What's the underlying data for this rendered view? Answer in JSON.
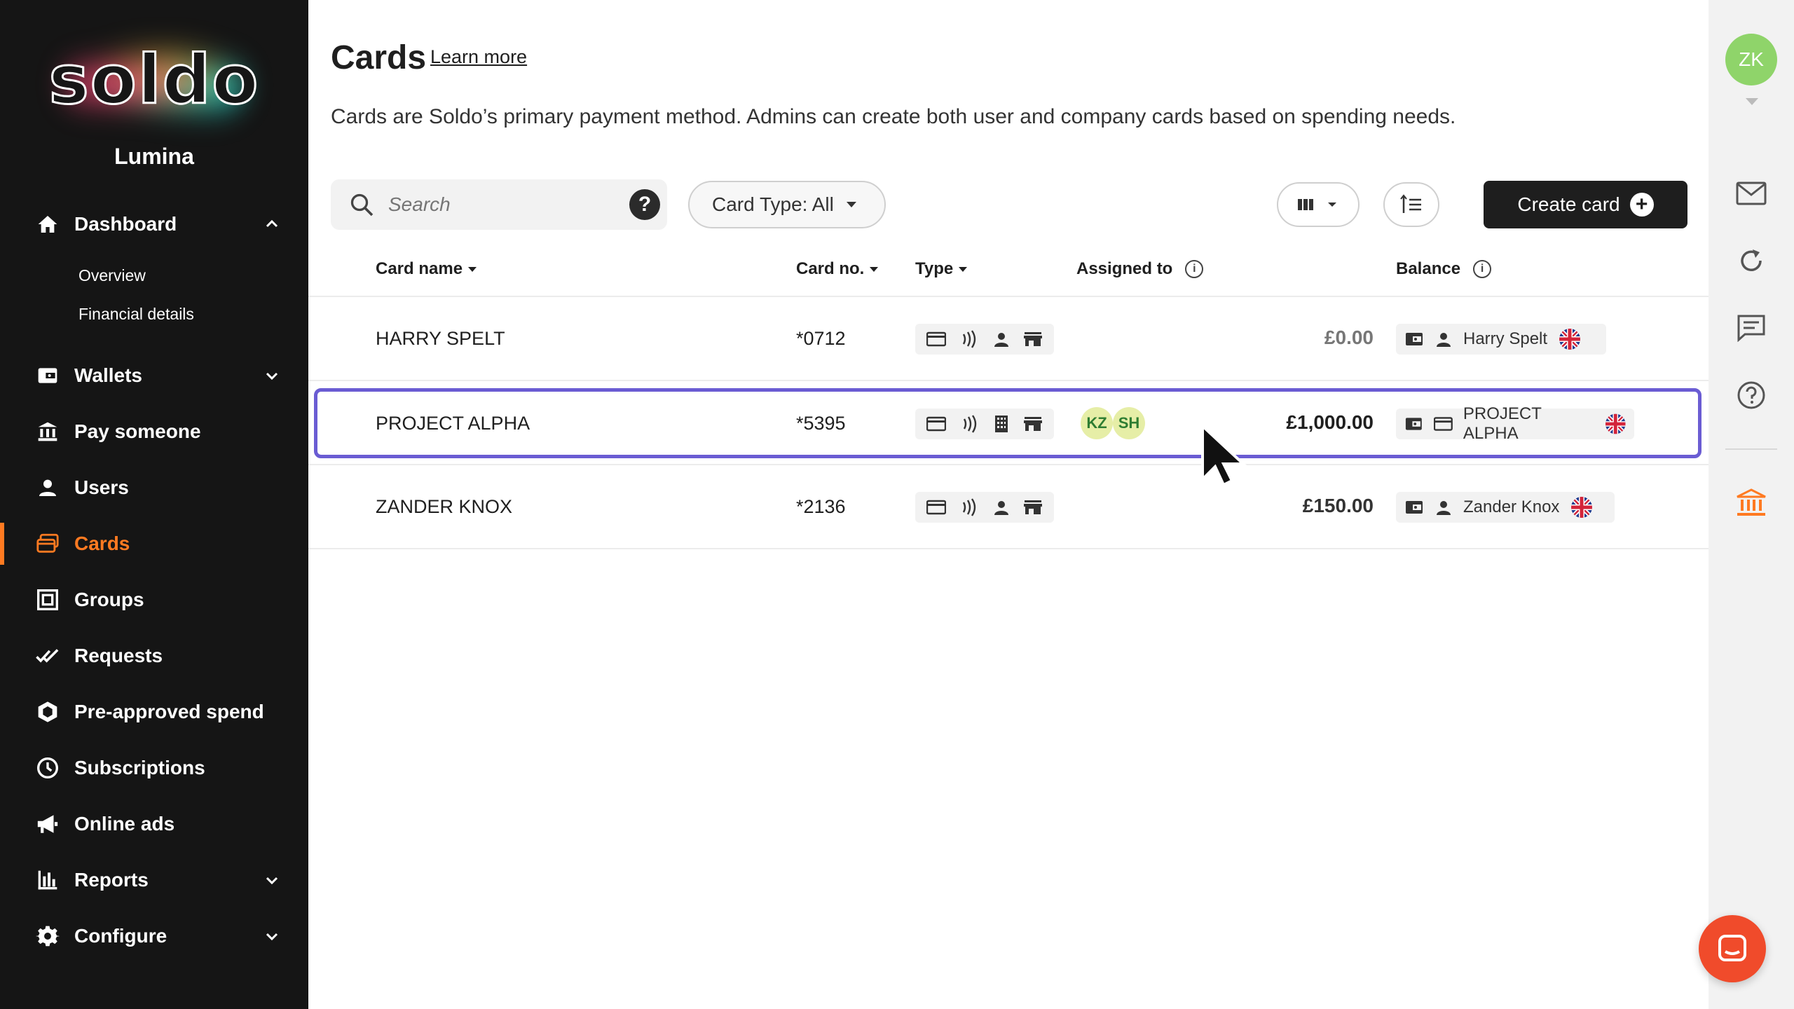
{
  "sidebar": {
    "logo_text": "soldo",
    "org_name": "Lumina",
    "nav": {
      "dashboard": "Dashboard",
      "overview": "Overview",
      "financial_details": "Financial details",
      "wallets": "Wallets",
      "pay_someone": "Pay someone",
      "users": "Users",
      "cards": "Cards",
      "groups": "Groups",
      "requests": "Requests",
      "pre_approved": "Pre-approved spend",
      "subscriptions": "Subscriptions",
      "online_ads": "Online ads",
      "reports": "Reports",
      "configure": "Configure"
    },
    "active_item": "Cards"
  },
  "main": {
    "title": "Cards",
    "learn_more": "Learn more",
    "description": "Cards are Soldo’s primary payment method. Admins can create both user and company cards based on spending needs.",
    "search_placeholder": "Search",
    "filter_label": "Card Type: All",
    "create_label": "Create card"
  },
  "table": {
    "headers": {
      "card_name": "Card name",
      "card_no": "Card no.",
      "type": "Type",
      "assigned_to": "Assigned to",
      "balance": "Balance"
    },
    "rows": [
      {
        "name": "HARRY SPELT",
        "card_no": "*0712",
        "type_icons": [
          "card-icon",
          "contactless-icon",
          "person-icon",
          "store-icon"
        ],
        "assigned": [],
        "balance": "£0.00",
        "owner": "Harry Spelt",
        "owner_icon": "person-icon",
        "flag": "uk-flag-icon"
      },
      {
        "name": "PROJECT ALPHA",
        "card_no": "*5395",
        "type_icons": [
          "card-icon",
          "contactless-icon",
          "building-icon",
          "store-icon"
        ],
        "assigned": [
          "KZ",
          "SH"
        ],
        "balance": "£1,000.00",
        "owner": "PROJECT ALPHA",
        "owner_icon": "card-icon",
        "flag": "uk-flag-icon"
      },
      {
        "name": "ZANDER KNOX",
        "card_no": "*2136",
        "type_icons": [
          "card-icon",
          "contactless-icon",
          "person-icon",
          "store-icon"
        ],
        "assigned": [],
        "balance": "£150.00",
        "owner": "Zander Knox",
        "owner_icon": "person-icon",
        "flag": "uk-flag-icon"
      }
    ]
  },
  "rail": {
    "avatar_initials": "ZK",
    "icons": [
      "mail-icon",
      "refresh-icon",
      "chat-icon",
      "help-icon",
      "bank-icon"
    ]
  },
  "colors": {
    "accent": "#ff7a21",
    "highlight_border": "#6a5cd3",
    "sidebar_bg": "#151515",
    "chat_button": "#f04b2b",
    "avatar_green": "#8fd46a"
  }
}
